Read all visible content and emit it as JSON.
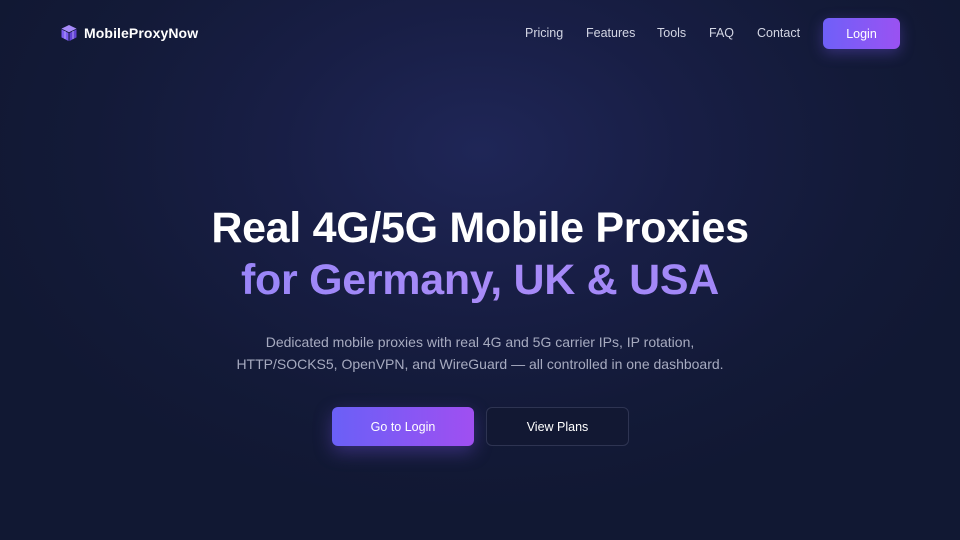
{
  "brand": {
    "name": "MobileProxyNow",
    "icon": "cube-logo-icon",
    "accent_color": "#8b5cf6"
  },
  "nav": {
    "links": [
      "Pricing",
      "Features",
      "Tools",
      "FAQ",
      "Contact"
    ],
    "login_label": "Login"
  },
  "hero": {
    "title_line1": "Real 4G/5G Mobile Proxies",
    "title_line2": "for Germany, UK & USA",
    "subtitle_line1": "Dedicated mobile proxies with real 4G and 5G carrier IPs, IP rotation,",
    "subtitle_line2": "HTTP/SOCKS5, OpenVPN, and WireGuard — all controlled in one dashboard.",
    "primary_cta": "Go to Login",
    "secondary_cta": "View Plans"
  },
  "colors": {
    "background": "#111833",
    "gradient_start": "#6a60f7",
    "gradient_end": "#a04ff1",
    "highlight_text": "#9a82f6"
  }
}
